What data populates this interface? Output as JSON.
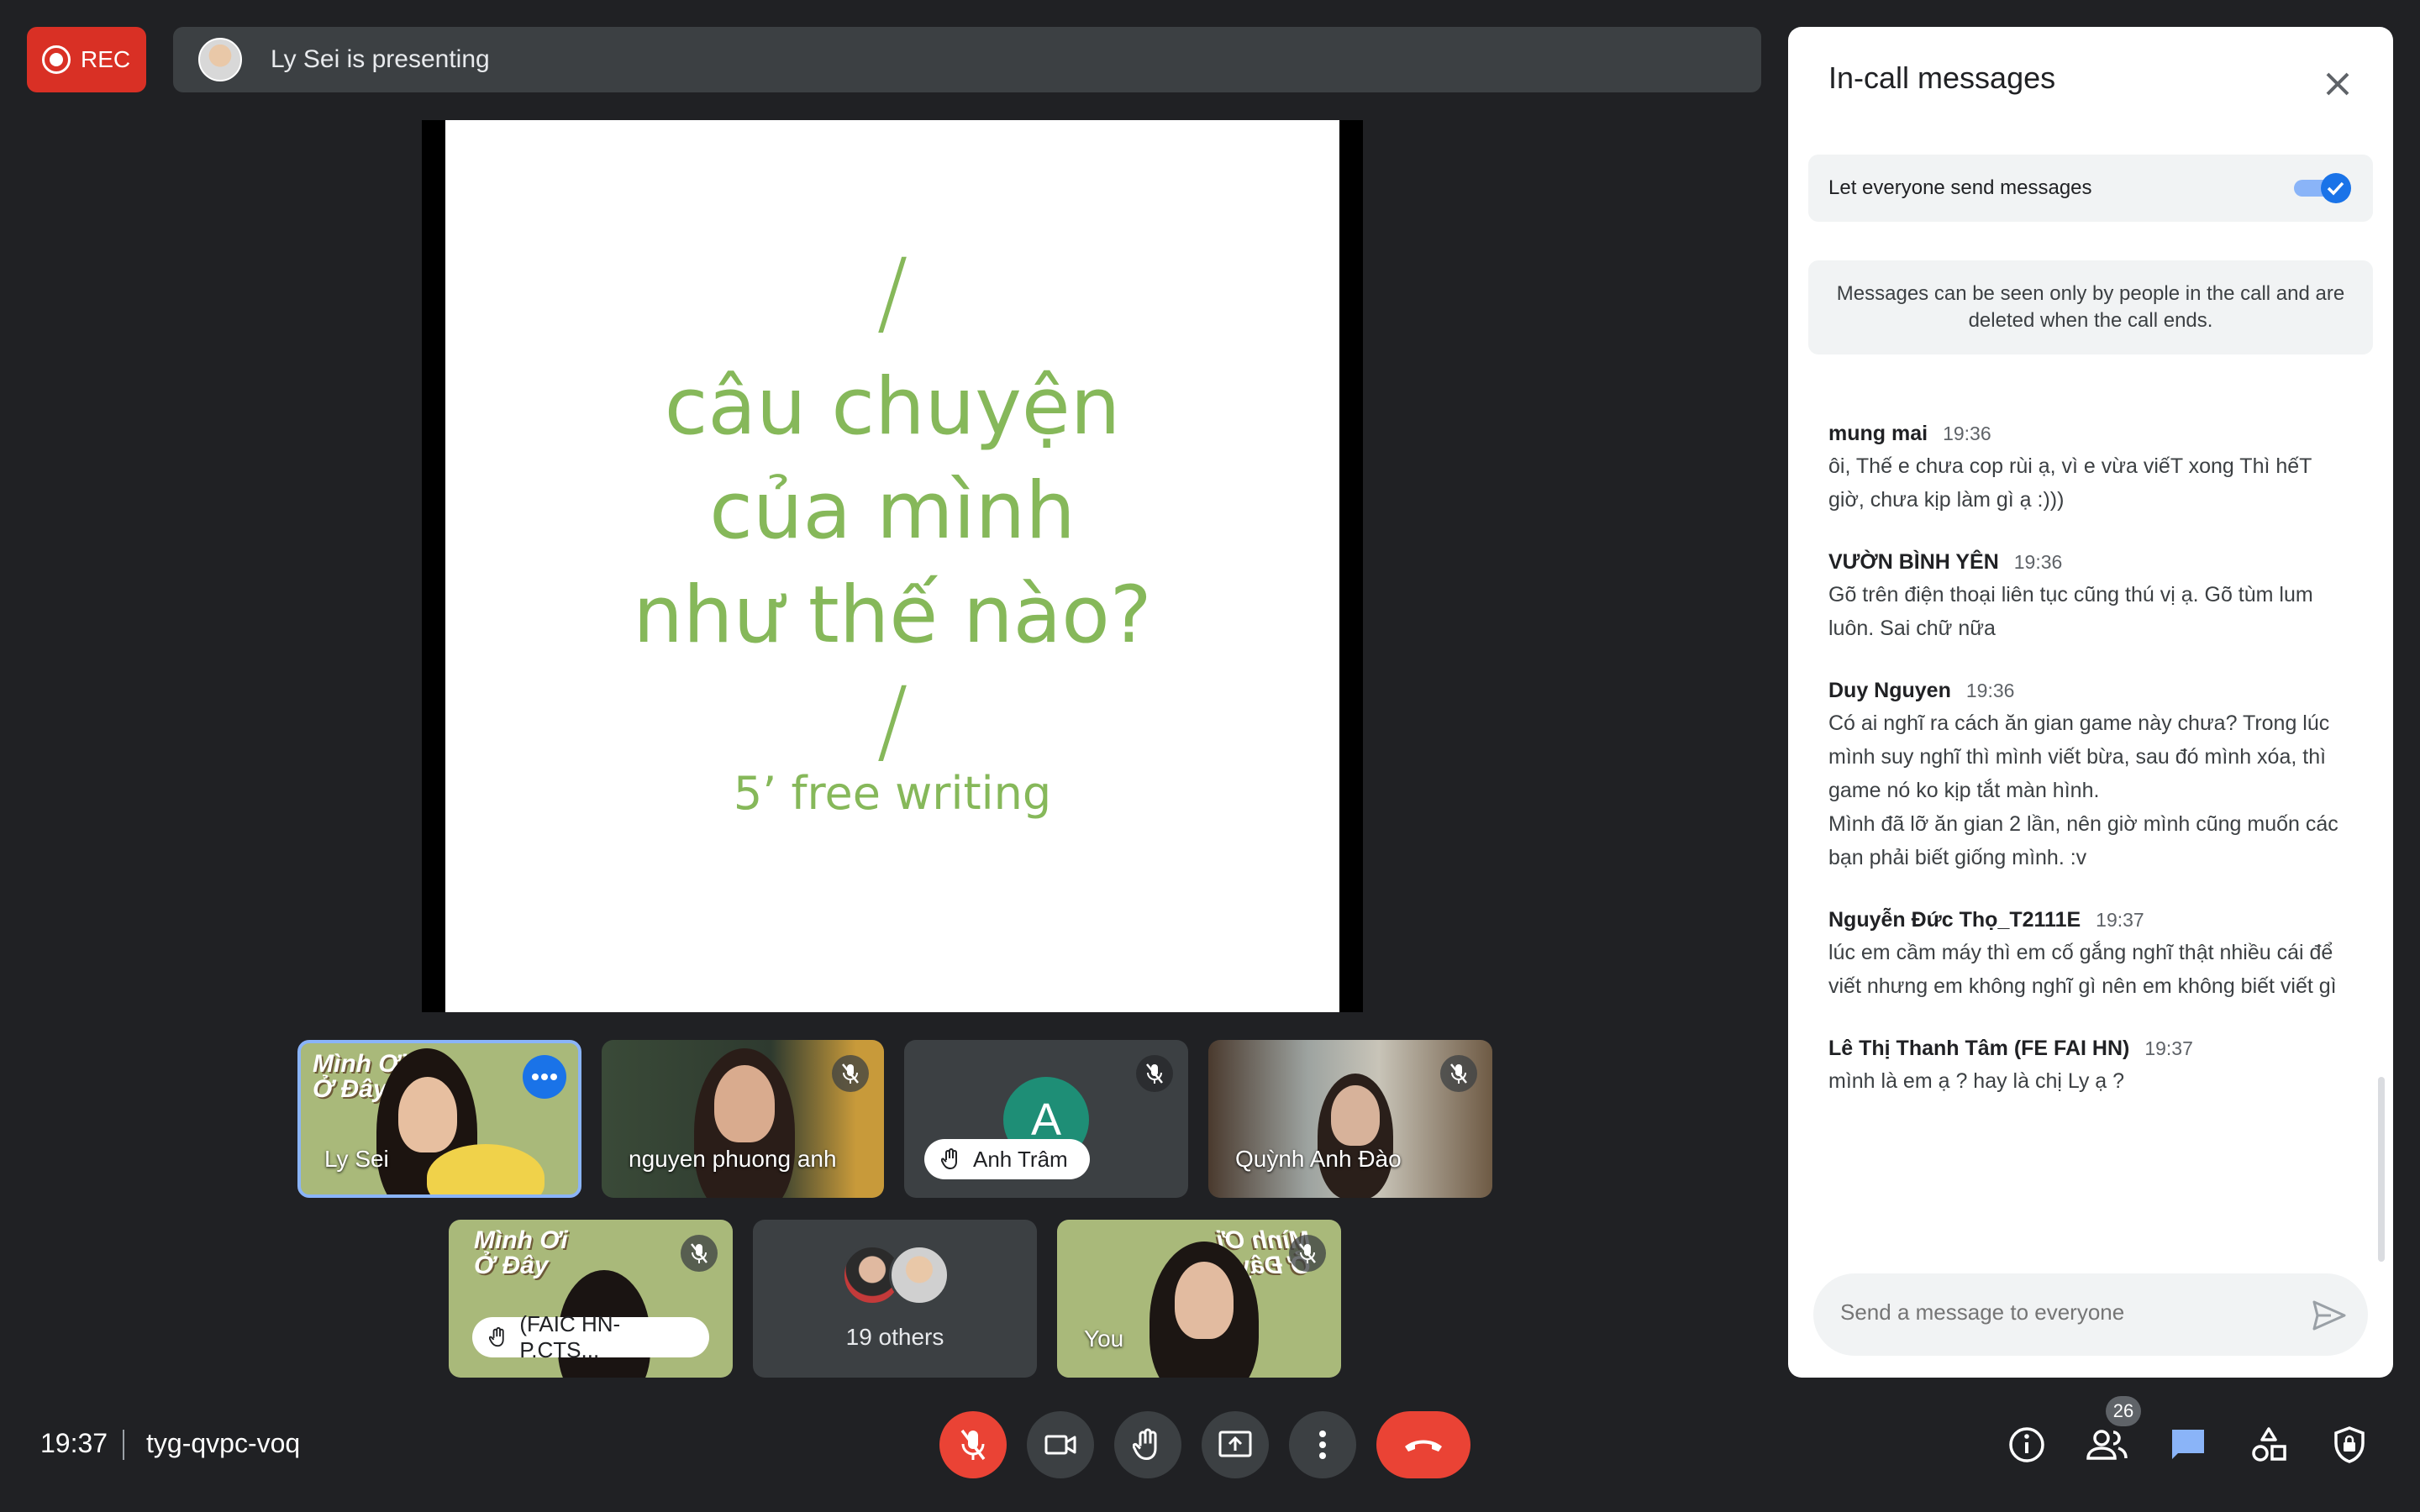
{
  "top": {
    "rec_label": "REC",
    "presenting": "Ly Sei is presenting"
  },
  "slide": {
    "slash_top": "/",
    "lines": [
      "câu chuyện",
      "của mình",
      "như thế nào?"
    ],
    "slash_bottom": "/",
    "subtitle": "5’ free writing"
  },
  "tiles": {
    "t1": {
      "name": "Ly Sei",
      "poster": "Mình Ơi\nỞ Đây"
    },
    "t2": {
      "name": "nguyen phuong anh"
    },
    "t3": {
      "avatar_letter": "A",
      "name": "Anh Trâm"
    },
    "t4": {
      "name": "Quỳnh Anh Đào"
    },
    "t5": {
      "name": "(FAIC HN-P.CTS...",
      "poster": "Mình Ơi\nỞ Đây"
    },
    "t6": {
      "label": "19 others"
    },
    "t7": {
      "name": "You",
      "poster": "Mình Ơi\nỞ Đây"
    }
  },
  "panel": {
    "title": "In-call messages",
    "toggle_label": "Let everyone send messages",
    "toggle_on": true,
    "info": "Messages can be seen only by people in the call and are deleted when the call ends.",
    "messages": [
      {
        "sender": "mung mai",
        "time": "19:36",
        "text": "ôi, Thế e chưa cop rùi ạ, vì e vừa viếT xong Thì hếT giờ, chưa kịp làm gì ạ :)))"
      },
      {
        "sender": "VƯỜN BÌNH YÊN",
        "time": "19:36",
        "text": "Gõ trên điện thoại liên tục cũng thú vị ạ.  Gõ tùm lum luôn. Sai chữ nữa"
      },
      {
        "sender": "Duy Nguyen",
        "time": "19:36",
        "text": "Có ai nghĩ ra cách ăn gian game này chưa? Trong lúc mình suy nghĩ thì mình viết bừa, sau đó mình xóa, thì game nó ko kịp tắt màn hình.\nMình đã lỡ ăn gian 2 lần, nên giờ mình cũng muốn các bạn phải biết giống mình. :v"
      },
      {
        "sender": "Nguyễn Đức Thọ_T2111E",
        "time": "19:37",
        "text": "lúc em cầm máy thì em cố gắng nghĩ thật nhiều cái để viết nhưng em không nghĩ gì nên em không biết viết gì"
      },
      {
        "sender": "Lê Thị Thanh Tâm (FE FAI HN)",
        "time": "19:37",
        "text": "mình là em ạ ? hay là chị Ly ạ ?"
      }
    ],
    "input_placeholder": "Send a message to everyone"
  },
  "bottom": {
    "time": "19:37",
    "meeting_code": "tyg-qvpc-voq",
    "participants_count": "26"
  },
  "colors": {
    "accent": "#1a73e8",
    "danger": "#ea4335",
    "slide_text": "#86b85a"
  }
}
